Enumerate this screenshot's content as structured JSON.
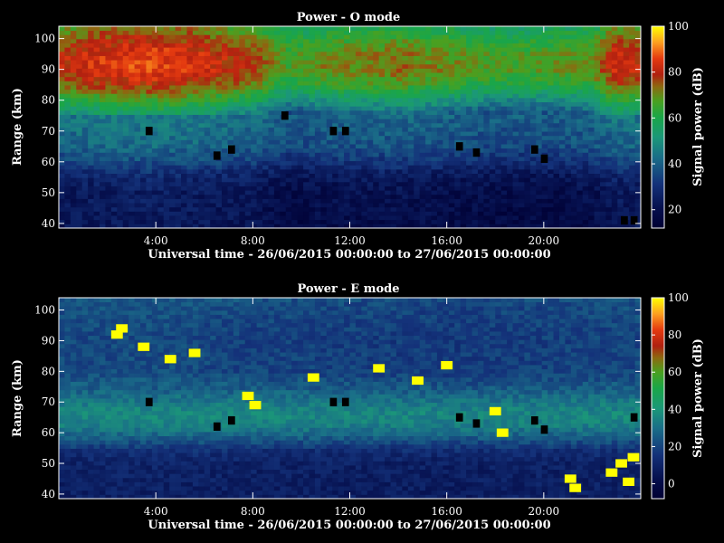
{
  "chart_data": [
    {
      "type": "heatmap",
      "title": "Power - O mode",
      "xlabel": "Universal time - 26/06/2015 00:00:00 to 27/06/2015 00:00:00",
      "ylabel": "Range (km)",
      "xlim": [
        0,
        24
      ],
      "ylim": [
        38.5,
        104
      ],
      "x_ticks": [
        4,
        8,
        12,
        16,
        20
      ],
      "x_tick_labels": [
        "4:00",
        "8:00",
        "12:00",
        "16:00",
        "20:00"
      ],
      "y_ticks": [
        40,
        50,
        60,
        70,
        80,
        90,
        100
      ],
      "y_tick_labels": [
        "40",
        "50",
        "60",
        "70",
        "80",
        "90",
        "100"
      ],
      "colorbar": {
        "label": "Signal power (dB)",
        "range": [
          12,
          100
        ],
        "ticks": [
          20,
          40,
          60,
          80,
          100
        ],
        "tick_labels": [
          "20",
          "40",
          "60",
          "80",
          "100"
        ]
      },
      "profile": [
        {
          "range_km": 40,
          "power_db": 20
        },
        {
          "range_km": 50,
          "power_db": 21
        },
        {
          "range_km": 55,
          "power_db": 24
        },
        {
          "range_km": 60,
          "power_db": 32
        },
        {
          "range_km": 65,
          "power_db": 38
        },
        {
          "range_km": 70,
          "power_db": 40
        },
        {
          "range_km": 75,
          "power_db": 42
        },
        {
          "range_km": 80,
          "power_db": 55
        },
        {
          "range_km": 85,
          "power_db": 68
        },
        {
          "range_km": 90,
          "power_db": 75
        },
        {
          "range_km": 95,
          "power_db": 74
        },
        {
          "range_km": 100,
          "power_db": 68
        },
        {
          "range_km": 104,
          "power_db": 62
        }
      ],
      "time_modulation": [
        {
          "hour": 0,
          "offset_db": 5
        },
        {
          "hour": 2,
          "offset_db": 10
        },
        {
          "hour": 4,
          "offset_db": 12
        },
        {
          "hour": 6,
          "offset_db": 8
        },
        {
          "hour": 8,
          "offset_db": 3
        },
        {
          "hour": 9.5,
          "offset_db": -8
        },
        {
          "hour": 11,
          "offset_db": -4
        },
        {
          "hour": 14,
          "offset_db": -1
        },
        {
          "hour": 16,
          "offset_db": -4
        },
        {
          "hour": 18,
          "offset_db": -8
        },
        {
          "hour": 20,
          "offset_db": -7
        },
        {
          "hour": 22,
          "offset_db": -4
        },
        {
          "hour": 23,
          "offset_db": 8
        },
        {
          "hour": 24,
          "offset_db": 6
        }
      ],
      "gaps": [
        {
          "t": 3.7,
          "range_km": 70
        },
        {
          "t": 6.5,
          "range_km": 62
        },
        {
          "t": 7.1,
          "range_km": 64
        },
        {
          "t": 9.3,
          "range_km": 75
        },
        {
          "t": 11.3,
          "range_km": 70
        },
        {
          "t": 11.8,
          "range_km": 70
        },
        {
          "t": 16.5,
          "range_km": 65
        },
        {
          "t": 17.2,
          "range_km": 63
        },
        {
          "t": 19.6,
          "range_km": 64
        },
        {
          "t": 20.0,
          "range_km": 61
        },
        {
          "t": 23.3,
          "range_km": 41
        },
        {
          "t": 23.7,
          "range_km": 41
        }
      ]
    },
    {
      "type": "heatmap",
      "title": "Power - E mode",
      "xlabel": "Universal time - 26/06/2015 00:00:00 to 27/06/2015 00:00:00",
      "ylabel": "Range (km)",
      "xlim": [
        0,
        24
      ],
      "ylim": [
        38.5,
        104
      ],
      "x_ticks": [
        4,
        8,
        12,
        16,
        20
      ],
      "x_tick_labels": [
        "4:00",
        "8:00",
        "12:00",
        "16:00",
        "20:00"
      ],
      "y_ticks": [
        40,
        50,
        60,
        70,
        80,
        90,
        100
      ],
      "y_tick_labels": [
        "40",
        "50",
        "60",
        "70",
        "80",
        "90",
        "100"
      ],
      "colorbar": {
        "label": "Signal power (dB)",
        "range": [
          -8,
          100
        ],
        "ticks": [
          0,
          20,
          40,
          60,
          80,
          100
        ],
        "tick_labels": [
          "0",
          "20",
          "40",
          "60",
          "80",
          "100"
        ]
      },
      "profile": [
        {
          "range_km": 40,
          "power_db": 8
        },
        {
          "range_km": 50,
          "power_db": 9
        },
        {
          "range_km": 54,
          "power_db": 13
        },
        {
          "range_km": 58,
          "power_db": 24
        },
        {
          "range_km": 62,
          "power_db": 33
        },
        {
          "range_km": 66,
          "power_db": 36
        },
        {
          "range_km": 70,
          "power_db": 32
        },
        {
          "range_km": 75,
          "power_db": 24
        },
        {
          "range_km": 80,
          "power_db": 19
        },
        {
          "range_km": 90,
          "power_db": 18
        },
        {
          "range_km": 100,
          "power_db": 20
        },
        {
          "range_km": 104,
          "power_db": 22
        }
      ],
      "time_modulation": [
        {
          "hour": 0,
          "offset_db": 2
        },
        {
          "hour": 4,
          "offset_db": 3
        },
        {
          "hour": 8,
          "offset_db": 1
        },
        {
          "hour": 12,
          "offset_db": 0
        },
        {
          "hour": 16,
          "offset_db": -1
        },
        {
          "hour": 20,
          "offset_db": 0
        },
        {
          "hour": 24,
          "offset_db": 2
        }
      ],
      "saturated": [
        {
          "t": 2.4,
          "range_km": 92
        },
        {
          "t": 2.6,
          "range_km": 94
        },
        {
          "t": 3.5,
          "range_km": 88
        },
        {
          "t": 4.6,
          "range_km": 84
        },
        {
          "t": 5.6,
          "range_km": 86
        },
        {
          "t": 7.8,
          "range_km": 72
        },
        {
          "t": 8.1,
          "range_km": 69
        },
        {
          "t": 10.5,
          "range_km": 78
        },
        {
          "t": 13.2,
          "range_km": 81
        },
        {
          "t": 14.8,
          "range_km": 77
        },
        {
          "t": 16.0,
          "range_km": 82
        },
        {
          "t": 18.0,
          "range_km": 67
        },
        {
          "t": 18.3,
          "range_km": 60
        },
        {
          "t": 21.1,
          "range_km": 45
        },
        {
          "t": 21.3,
          "range_km": 42
        },
        {
          "t": 22.8,
          "range_km": 47
        },
        {
          "t": 23.2,
          "range_km": 50
        },
        {
          "t": 23.5,
          "range_km": 44
        },
        {
          "t": 23.7,
          "range_km": 52
        }
      ],
      "gaps": [
        {
          "t": 3.7,
          "range_km": 70
        },
        {
          "t": 6.5,
          "range_km": 62
        },
        {
          "t": 7.1,
          "range_km": 64
        },
        {
          "t": 11.3,
          "range_km": 70
        },
        {
          "t": 11.8,
          "range_km": 70
        },
        {
          "t": 16.5,
          "range_km": 65
        },
        {
          "t": 17.2,
          "range_km": 63
        },
        {
          "t": 19.6,
          "range_km": 64
        },
        {
          "t": 20.0,
          "range_km": 61
        },
        {
          "t": 23.7,
          "range_km": 65
        }
      ]
    }
  ]
}
